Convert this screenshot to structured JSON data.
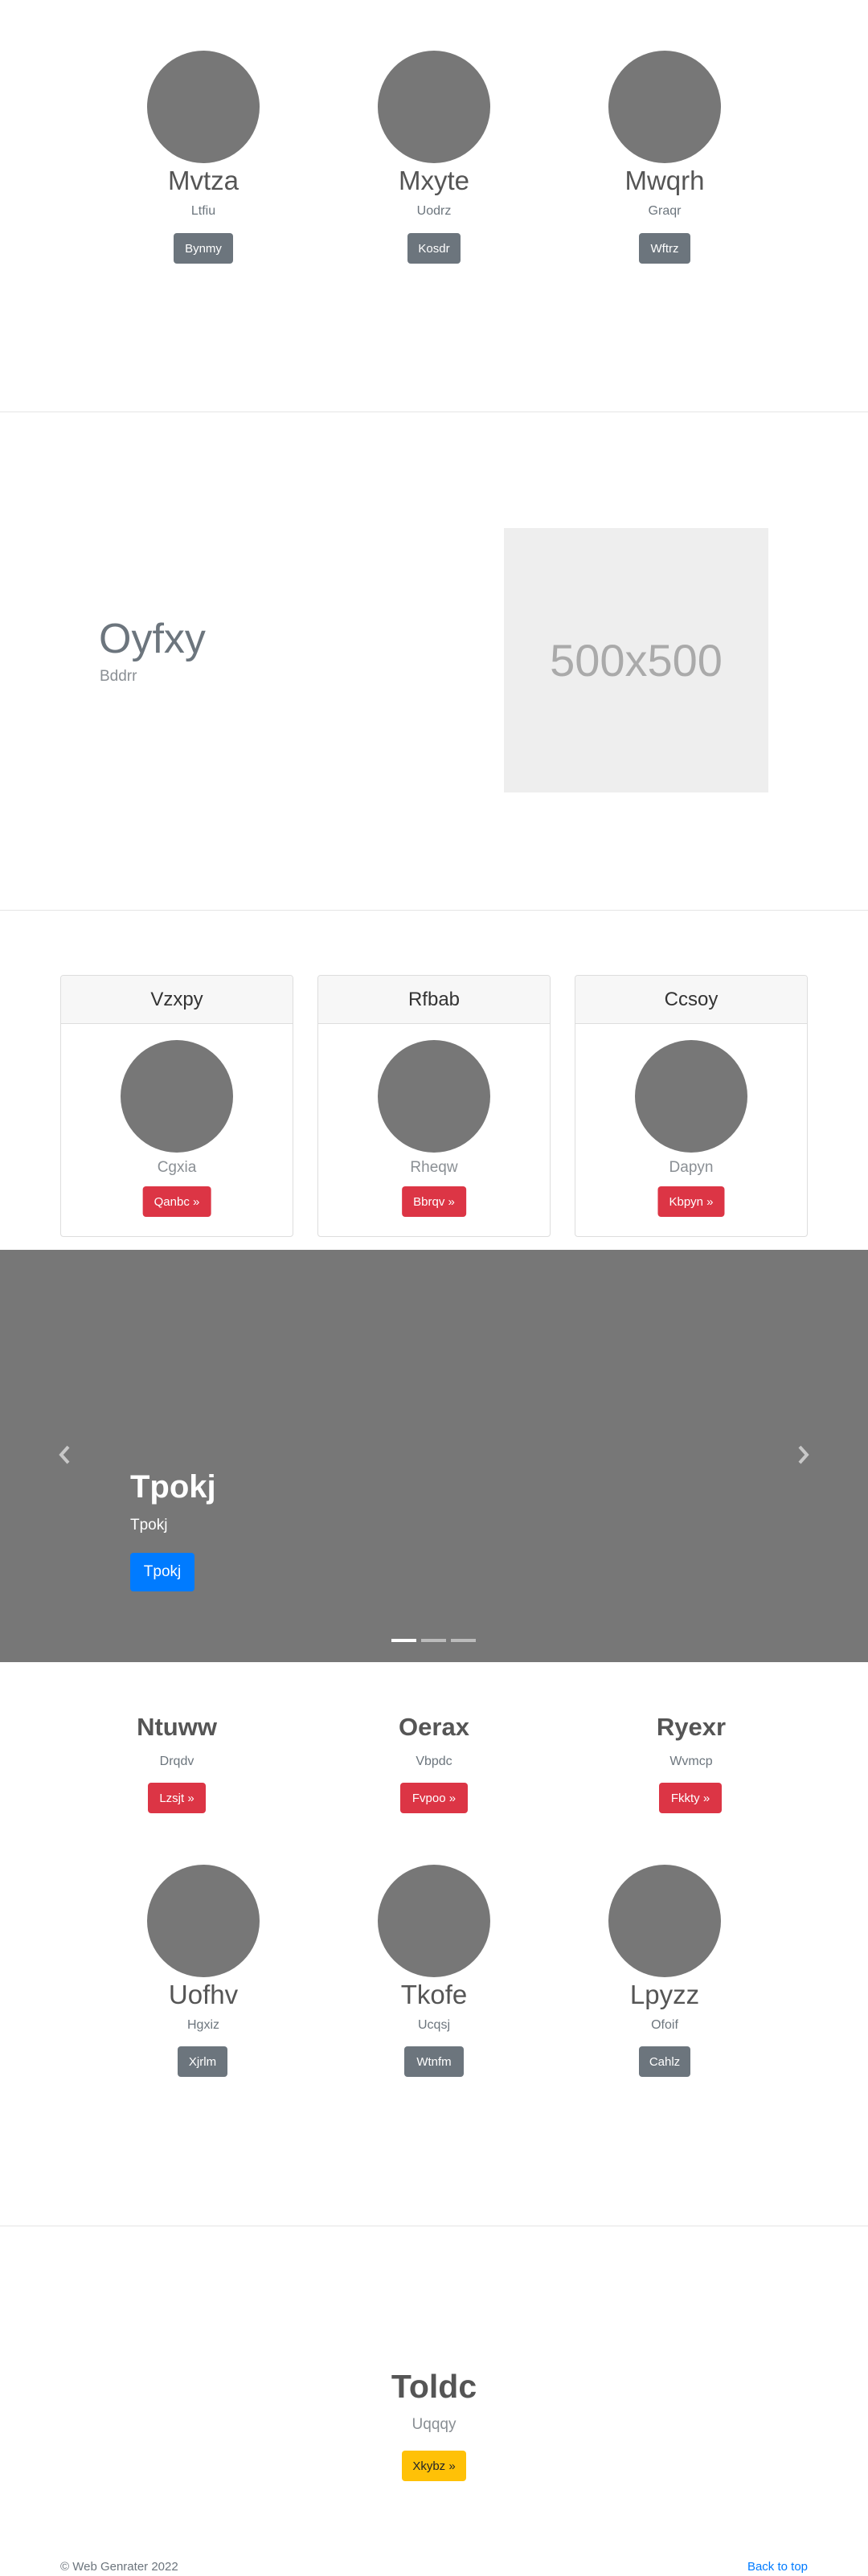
{
  "team_row_1": [
    {
      "name": "Mvtza",
      "role": "Ltfiu",
      "button": "Bynmy"
    },
    {
      "name": "Mxyte",
      "role": "Uodrz",
      "button": "Kosdr"
    },
    {
      "name": "Mwqrh",
      "role": "Graqr",
      "button": "Wftrz"
    }
  ],
  "feature": {
    "title": "Oyfxy",
    "subtitle": "Bddrr",
    "image_label": "500x500"
  },
  "cards": [
    {
      "header": "Vzxpy",
      "subtitle": "Cgxia",
      "button": "Qanbc »"
    },
    {
      "header": "Rfbab",
      "subtitle": "Rheqw",
      "button": "Bbrqv »"
    },
    {
      "header": "Ccsoy",
      "subtitle": "Dapyn",
      "button": "Kbpyn »"
    }
  ],
  "carousel": {
    "title": "Tpokj",
    "subtitle": "Tpokj",
    "button": "Tpokj",
    "prev_icon": "chevron-left-icon",
    "next_icon": "chevron-right-icon",
    "slide_count": 3,
    "active_slide": 1
  },
  "headings": [
    {
      "title": "Ntuww",
      "subtitle": "Drqdv",
      "button": "Lzsjt »"
    },
    {
      "title": "Oerax",
      "subtitle": "Vbpdc",
      "button": "Fvpoo »"
    },
    {
      "title": "Ryexr",
      "subtitle": "Wvmcp",
      "button": "Fkkty »"
    }
  ],
  "team_row_2": [
    {
      "name": "Uofhv",
      "role": "Hgxiz",
      "button": "Xjrlm"
    },
    {
      "name": "Tkofe",
      "role": "Ucqsj",
      "button": "Wtnfm"
    },
    {
      "name": "Lpyzz",
      "role": "Ofoif",
      "button": "Cahlz"
    }
  ],
  "cta": {
    "title": "Toldc",
    "subtitle": "Uqqqy",
    "button": "Xkybz »"
  },
  "footer": {
    "copyright": "© Web Genrater 2022",
    "back_to_top": "Back to top"
  },
  "colors": {
    "primary": "#007bff",
    "danger": "#dc3545",
    "secondary": "#6c757d",
    "warning": "#ffc107",
    "placeholder_gray": "#777777"
  }
}
